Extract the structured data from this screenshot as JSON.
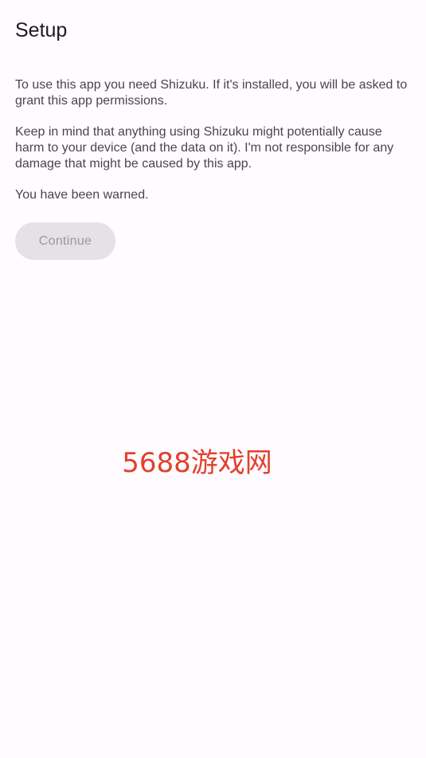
{
  "header": {
    "title": "Setup"
  },
  "body": {
    "paragraphs": [
      "To use this app you need Shizuku. If it's installed, you will be asked to grant this app permissions.",
      "Keep in mind that anything using Shizuku might potentially cause harm to your device (and the data on it). I'm not responsible for any damage that might be caused by this app.",
      "You have been warned."
    ]
  },
  "actions": {
    "continue_label": "Continue"
  },
  "watermark": {
    "text": "5688游戏网"
  },
  "colors": {
    "background": "#fffbfe",
    "title_text": "#1c1b1f",
    "body_text": "#49454f",
    "button_bg_disabled": "#e6e1e5",
    "button_text_disabled": "#9a979c",
    "watermark": "#e0412c"
  }
}
